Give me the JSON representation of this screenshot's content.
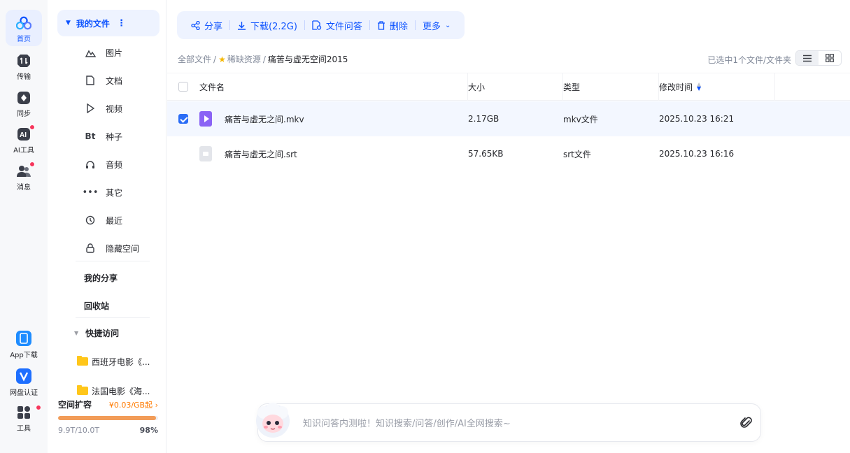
{
  "rail": {
    "items": [
      {
        "label": "首页",
        "icon": "home-cloud-icon"
      },
      {
        "label": "传输",
        "icon": "transfer-icon"
      },
      {
        "label": "同步",
        "icon": "sync-icon"
      },
      {
        "label": "AI工具",
        "icon": "ai-tools-icon"
      },
      {
        "label": "消息",
        "icon": "message-icon"
      },
      {
        "label": "App下载",
        "icon": "app-download-icon"
      },
      {
        "label": "网盘认证",
        "icon": "verify-icon"
      },
      {
        "label": "工具",
        "icon": "tools-grid-icon"
      }
    ]
  },
  "sidebar": {
    "my_files": "我的文件",
    "categories": [
      {
        "label": "图片",
        "icon": "image-icon"
      },
      {
        "label": "文档",
        "icon": "document-icon"
      },
      {
        "label": "视频",
        "icon": "video-icon"
      },
      {
        "label": "种子",
        "icon": "torrent-icon"
      },
      {
        "label": "音频",
        "icon": "audio-icon"
      },
      {
        "label": "其它",
        "icon": "more-dots-icon"
      },
      {
        "label": "最近",
        "icon": "recent-icon"
      },
      {
        "label": "隐藏空间",
        "icon": "lock-icon"
      }
    ],
    "my_share": "我的分享",
    "recycle": "回收站",
    "quick_access": "快捷访问",
    "folders": [
      "西班牙电影《...",
      "法国电影《海..."
    ],
    "storage": {
      "title": "空间扩容",
      "price": "¥0.03/GB起 ›",
      "used": "9.9T/10.0T",
      "percent_label": "98%",
      "fraction": 0.98
    }
  },
  "toolbar": {
    "share": "分享",
    "download": "下载(2.2G)",
    "ask": "文件问答",
    "delete": "删除",
    "more": "更多"
  },
  "breadcrumb": {
    "root": "全部文件",
    "folder": "稀缺资源",
    "current": "痛苦与虚无空间2015",
    "sep": "/"
  },
  "selection_info": "已选中1个文件/文件夹",
  "table": {
    "headers": {
      "name": "文件名",
      "size": "大小",
      "type": "类型",
      "modified": "修改时间"
    },
    "rows": [
      {
        "name": "痛苦与虚无之间.mkv",
        "size": "2.17GB",
        "type": "mkv文件",
        "modified": "2025.10.23 16:21",
        "selected": true,
        "kind": "video"
      },
      {
        "name": "痛苦与虚无之间.srt",
        "size": "57.65KB",
        "type": "srt文件",
        "modified": "2025.10.23 16:16",
        "selected": false,
        "kind": "txt"
      }
    ]
  },
  "ai_search": {
    "placeholder": "知识问答内测啦！知识搜索/问答/创作/AI全网搜索~"
  },
  "colors": {
    "accent": "#0d53ff",
    "storage_bar": "#f29c58",
    "badge": "#f5365c"
  }
}
